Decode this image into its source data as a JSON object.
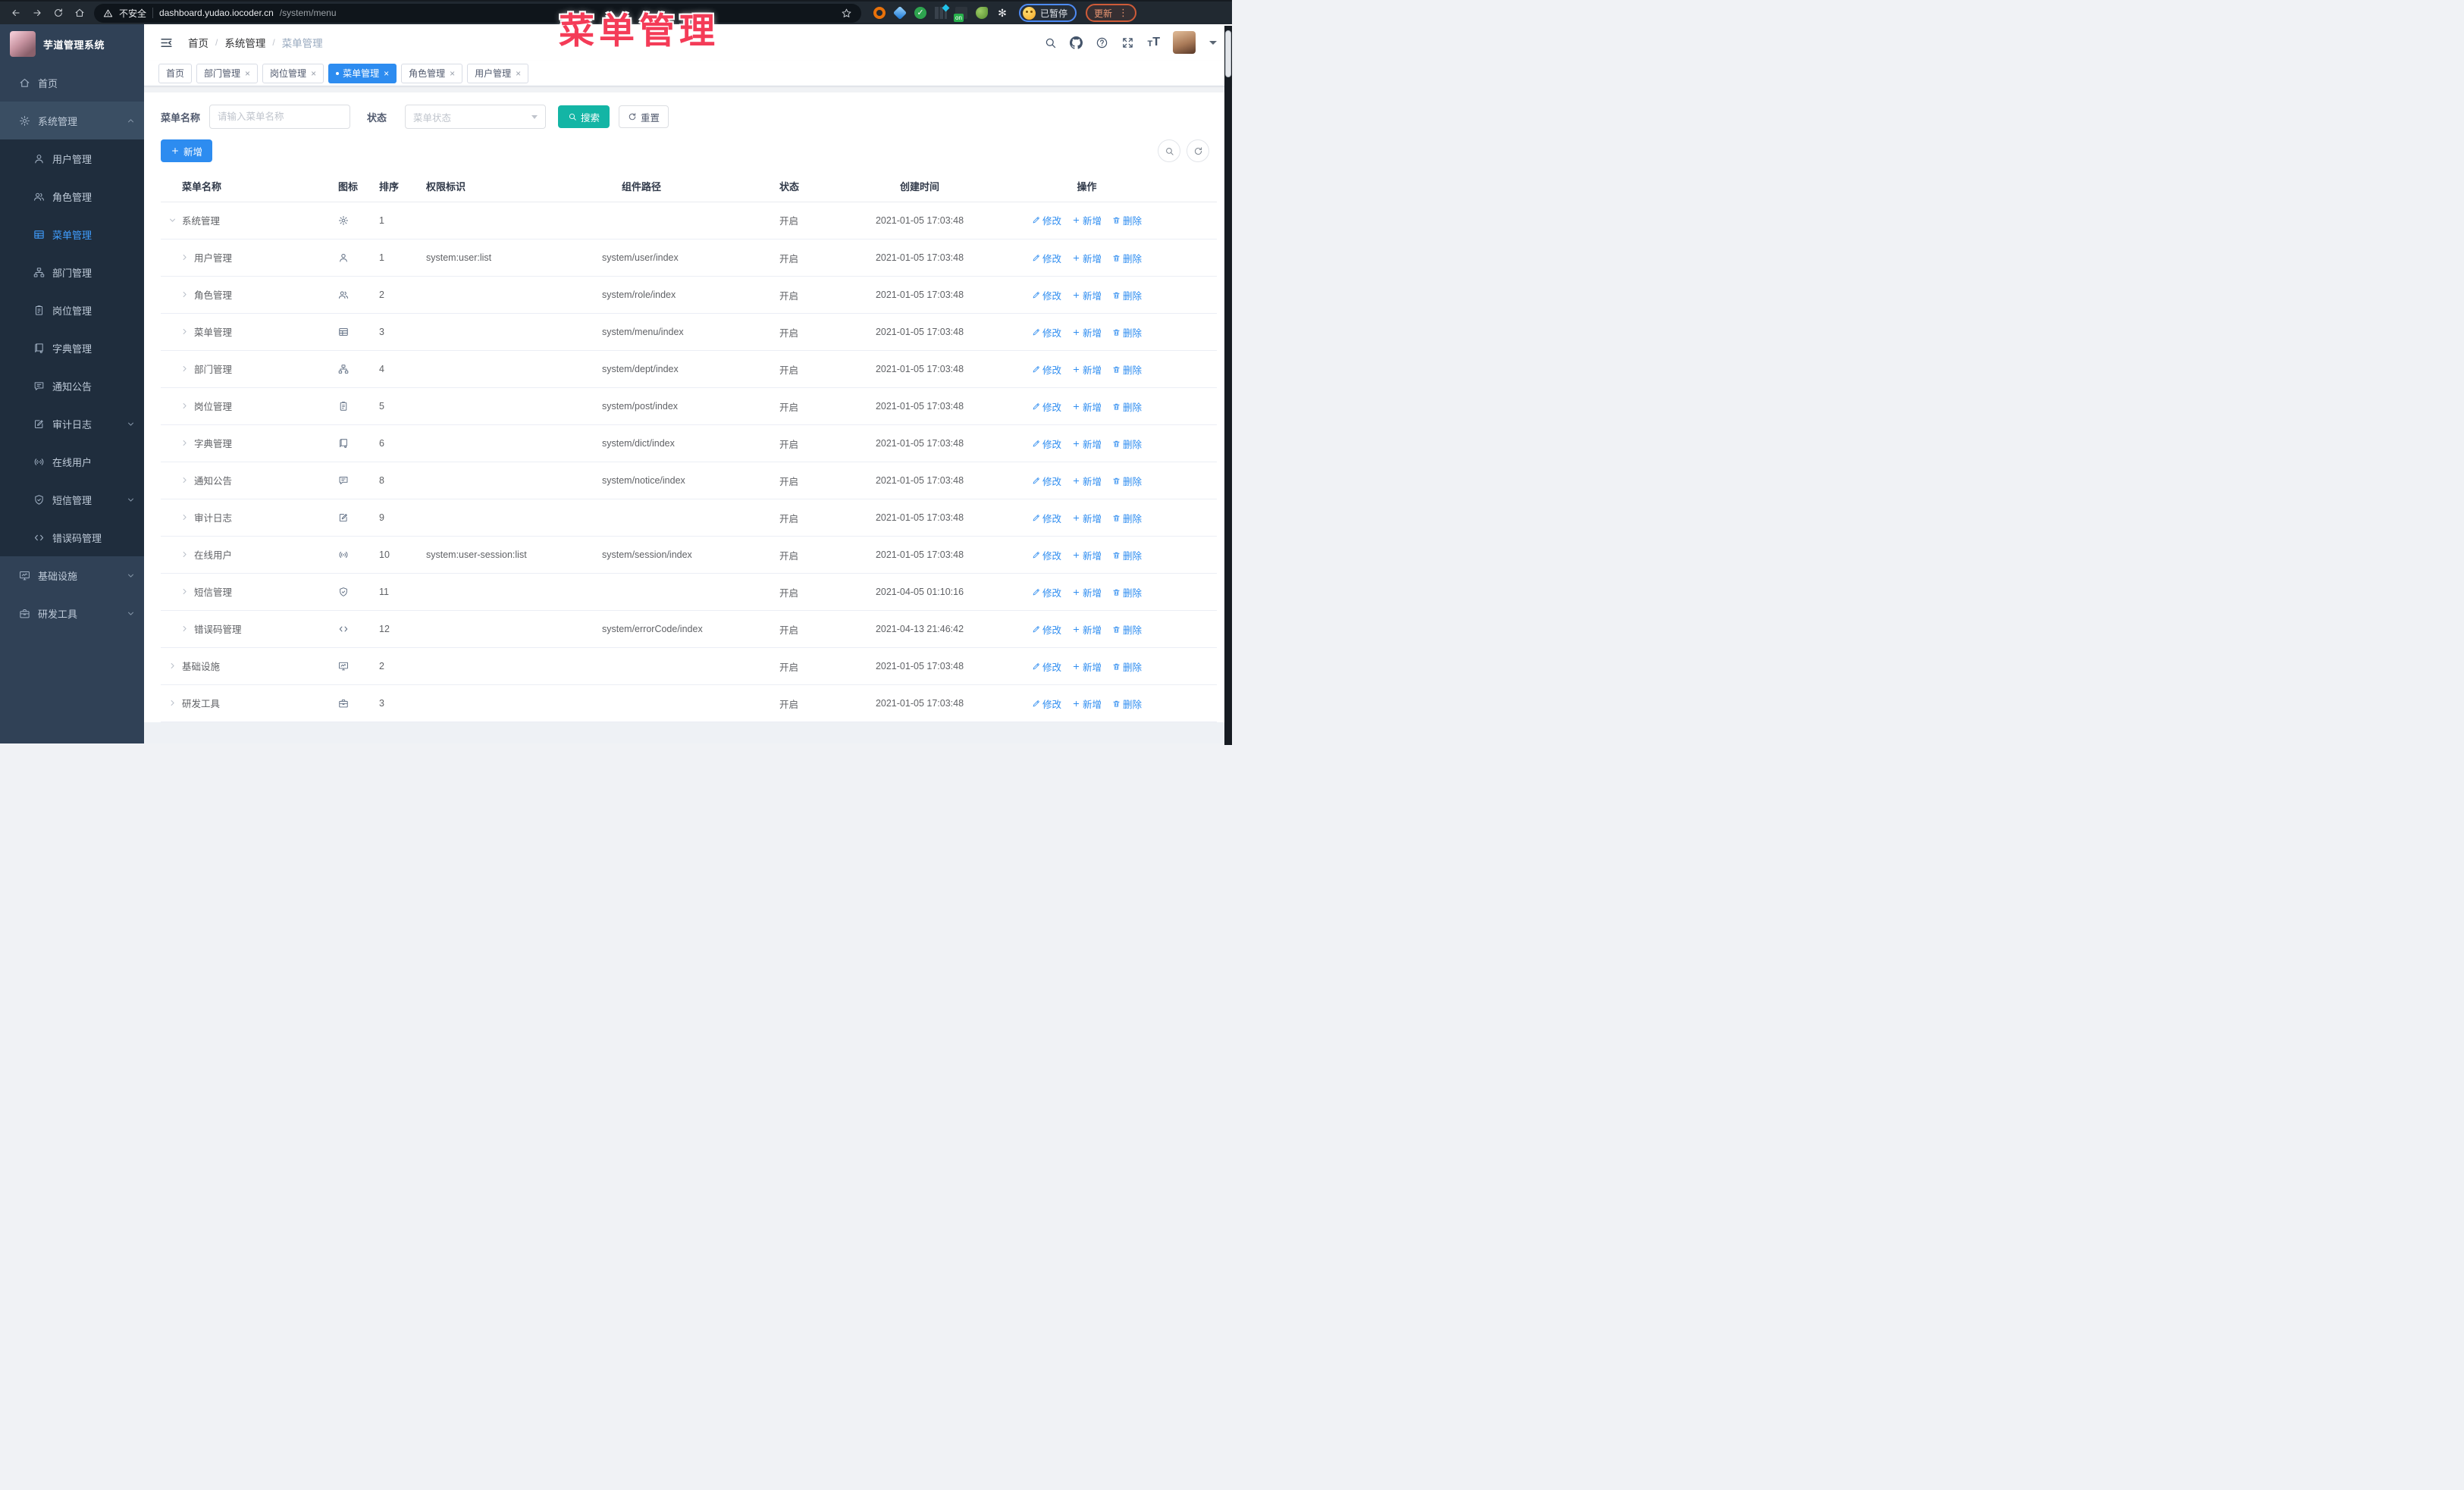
{
  "browser": {
    "security_label": "不安全",
    "url_host": "dashboard.yudao.iocoder.cn",
    "url_path": "/system/menu",
    "profile_label": "已暂停",
    "update_label": "更新",
    "nav_icons": [
      "back-arrow",
      "forward-arrow",
      "reload",
      "home"
    ],
    "extension_icons": [
      "ext-orange-ring",
      "ext-blue-gem",
      "ext-green-check",
      "ext-columns",
      "ext-on-badge",
      "ext-green-leaf",
      "ext-puzzle"
    ]
  },
  "overlay": {
    "text": "菜单管理",
    "color": "#f43b57"
  },
  "sidebar": {
    "title": "芋道管理系统",
    "items": [
      {
        "key": "home",
        "label": "首页",
        "icon": "home",
        "level": 0
      },
      {
        "key": "system",
        "label": "系统管理",
        "icon": "gear",
        "level": 0,
        "arrow": "up",
        "open": true
      },
      {
        "key": "user",
        "label": "用户管理",
        "icon": "user",
        "level": 1
      },
      {
        "key": "role",
        "label": "角色管理",
        "icon": "users",
        "level": 1
      },
      {
        "key": "menu",
        "label": "菜单管理",
        "icon": "menu",
        "level": 1,
        "active": true
      },
      {
        "key": "dept",
        "label": "部门管理",
        "icon": "tree",
        "level": 1
      },
      {
        "key": "post",
        "label": "岗位管理",
        "icon": "post",
        "level": 1
      },
      {
        "key": "dict",
        "label": "字典管理",
        "icon": "dict",
        "level": 1
      },
      {
        "key": "notice",
        "label": "通知公告",
        "icon": "notice",
        "level": 1
      },
      {
        "key": "audit",
        "label": "审计日志",
        "icon": "log",
        "level": 1,
        "arrow": "down"
      },
      {
        "key": "online",
        "label": "在线用户",
        "icon": "online",
        "level": 1
      },
      {
        "key": "sms",
        "label": "短信管理",
        "icon": "sms",
        "level": 1,
        "arrow": "down"
      },
      {
        "key": "errcode",
        "label": "错误码管理",
        "icon": "code",
        "level": 1
      },
      {
        "key": "infra",
        "label": "基础设施",
        "icon": "monitor",
        "level": 0,
        "arrow": "down"
      },
      {
        "key": "devtool",
        "label": "研发工具",
        "icon": "tool",
        "level": 0,
        "arrow": "down"
      }
    ]
  },
  "header": {
    "breadcrumb": [
      "首页",
      "系统管理",
      "菜单管理"
    ],
    "right_icons": [
      "search",
      "github",
      "help",
      "fullscreen",
      "font-size"
    ]
  },
  "tabs": [
    {
      "key": "home",
      "label": "首页"
    },
    {
      "key": "dept",
      "label": "部门管理",
      "closable": true
    },
    {
      "key": "post",
      "label": "岗位管理",
      "closable": true
    },
    {
      "key": "menu",
      "label": "菜单管理",
      "closable": true,
      "active": true
    },
    {
      "key": "role",
      "label": "角色管理",
      "closable": true
    },
    {
      "key": "user",
      "label": "用户管理",
      "closable": true
    }
  ],
  "filters": {
    "name_label": "菜单名称",
    "name_placeholder": "请输入菜单名称",
    "status_label": "状态",
    "status_placeholder": "菜单状态",
    "search_label": "搜索",
    "reset_label": "重置"
  },
  "toolbar": {
    "add_label": "新增"
  },
  "table": {
    "columns": [
      "菜单名称",
      "图标",
      "排序",
      "权限标识",
      "组件路径",
      "状态",
      "创建时间",
      "操作"
    ],
    "action_labels": {
      "edit": "修改",
      "add": "新增",
      "delete": "删除"
    },
    "rows": [
      {
        "name": "系统管理",
        "icon": "gear",
        "level": 0,
        "expanded": true,
        "sort": "1",
        "permission": "",
        "path": "",
        "status": "开启",
        "time": "2021-01-05 17:03:48"
      },
      {
        "name": "用户管理",
        "icon": "user",
        "level": 1,
        "sort": "1",
        "permission": "system:user:list",
        "path": "system/user/index",
        "status": "开启",
        "time": "2021-01-05 17:03:48"
      },
      {
        "name": "角色管理",
        "icon": "users",
        "level": 1,
        "sort": "2",
        "permission": "",
        "path": "system/role/index",
        "status": "开启",
        "time": "2021-01-05 17:03:48"
      },
      {
        "name": "菜单管理",
        "icon": "menu",
        "level": 1,
        "sort": "3",
        "permission": "",
        "path": "system/menu/index",
        "status": "开启",
        "time": "2021-01-05 17:03:48"
      },
      {
        "name": "部门管理",
        "icon": "tree",
        "level": 1,
        "sort": "4",
        "permission": "",
        "path": "system/dept/index",
        "status": "开启",
        "time": "2021-01-05 17:03:48"
      },
      {
        "name": "岗位管理",
        "icon": "post",
        "level": 1,
        "sort": "5",
        "permission": "",
        "path": "system/post/index",
        "status": "开启",
        "time": "2021-01-05 17:03:48"
      },
      {
        "name": "字典管理",
        "icon": "dict",
        "level": 1,
        "sort": "6",
        "permission": "",
        "path": "system/dict/index",
        "status": "开启",
        "time": "2021-01-05 17:03:48"
      },
      {
        "name": "通知公告",
        "icon": "notice",
        "level": 1,
        "sort": "8",
        "permission": "",
        "path": "system/notice/index",
        "status": "开启",
        "time": "2021-01-05 17:03:48"
      },
      {
        "name": "审计日志",
        "icon": "log",
        "level": 1,
        "sort": "9",
        "permission": "",
        "path": "",
        "status": "开启",
        "time": "2021-01-05 17:03:48"
      },
      {
        "name": "在线用户",
        "icon": "online",
        "level": 1,
        "sort": "10",
        "permission": "system:user-session:list",
        "path": "system/session/index",
        "status": "开启",
        "time": "2021-01-05 17:03:48"
      },
      {
        "name": "短信管理",
        "icon": "sms",
        "level": 1,
        "sort": "11",
        "permission": "",
        "path": "",
        "status": "开启",
        "time": "2021-04-05 01:10:16"
      },
      {
        "name": "错误码管理",
        "icon": "code",
        "level": 1,
        "sort": "12",
        "permission": "",
        "path": "system/errorCode/index",
        "status": "开启",
        "time": "2021-04-13 21:46:42"
      },
      {
        "name": "基础设施",
        "icon": "monitor",
        "level": 0,
        "sort": "2",
        "permission": "",
        "path": "",
        "status": "开启",
        "time": "2021-01-05 17:03:48"
      },
      {
        "name": "研发工具",
        "icon": "tool",
        "level": 0,
        "sort": "3",
        "permission": "",
        "path": "",
        "status": "开启",
        "time": "2021-01-05 17:03:48"
      }
    ]
  },
  "colors": {
    "accent_blue": "#2d8cf0",
    "active_link_blue": "#409eff",
    "search_teal": "#13b5a5",
    "sidebar_bg": "#304156",
    "submenu_bg": "#1f2d3d",
    "overlay_red": "#f43b57"
  }
}
